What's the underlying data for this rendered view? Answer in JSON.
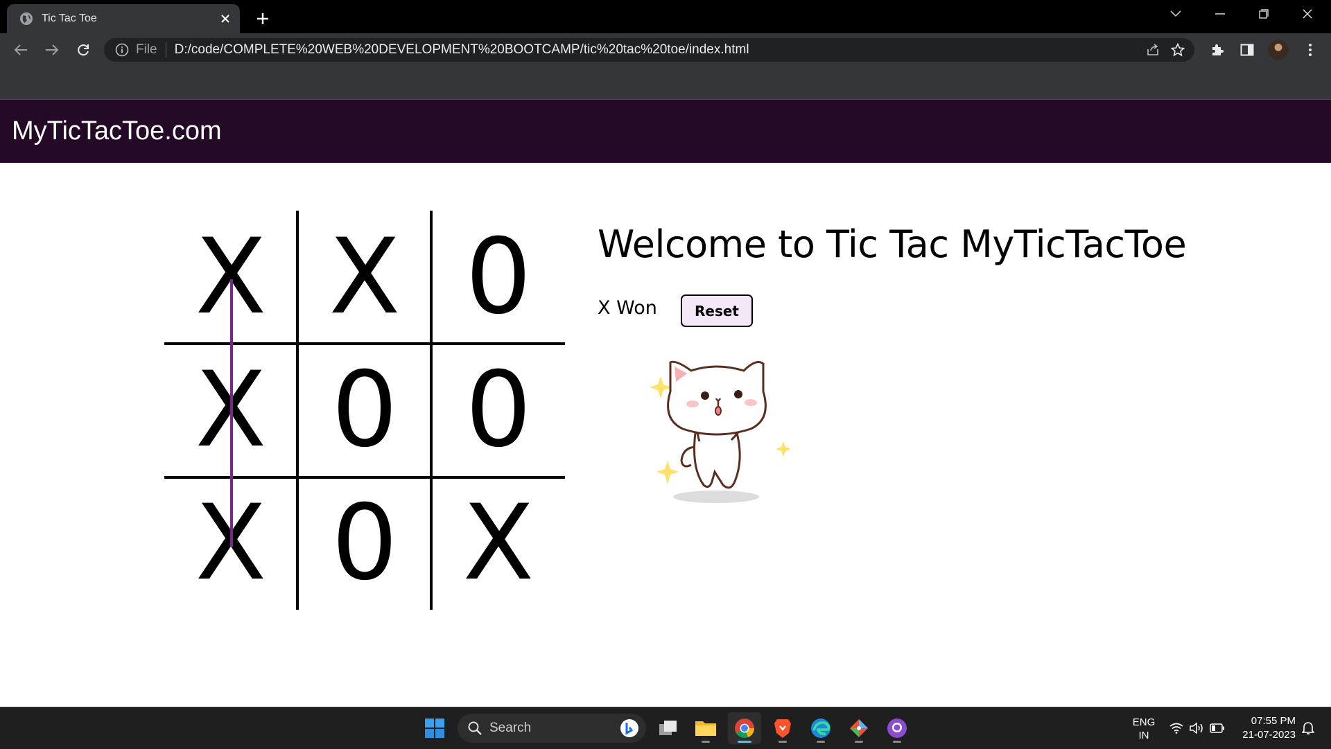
{
  "browser": {
    "tab_title": "Tic Tac Toe",
    "url_scheme": "File",
    "url": "D:/code/COMPLETE%20WEB%20DEVELOPMENT%20BOOTCAMP/tic%20tac%20toe/index.html"
  },
  "page": {
    "brand": "MyTicTacToe.com",
    "heading": "Welcome to Tic Tac MyTicTacToe",
    "status": "X Won",
    "reset_label": "Reset",
    "board": [
      "X",
      "X",
      "0",
      "X",
      "0",
      "0",
      "X",
      "0",
      "X"
    ],
    "winning_line": "column-1",
    "win_line_color": "#7b2390",
    "navbar_color": "#240a26",
    "reset_bg": "#f3e7f8"
  },
  "taskbar": {
    "search_placeholder": "Search",
    "apps": [
      "start-icon",
      "task-view-icon",
      "file-explorer-icon",
      "chrome-icon",
      "brave-icon",
      "edge-icon",
      "git-icon",
      "github-desktop-icon"
    ],
    "lang_line1": "ENG",
    "lang_line2": "IN",
    "time": "07:55 PM",
    "date": "21-07-2023"
  }
}
